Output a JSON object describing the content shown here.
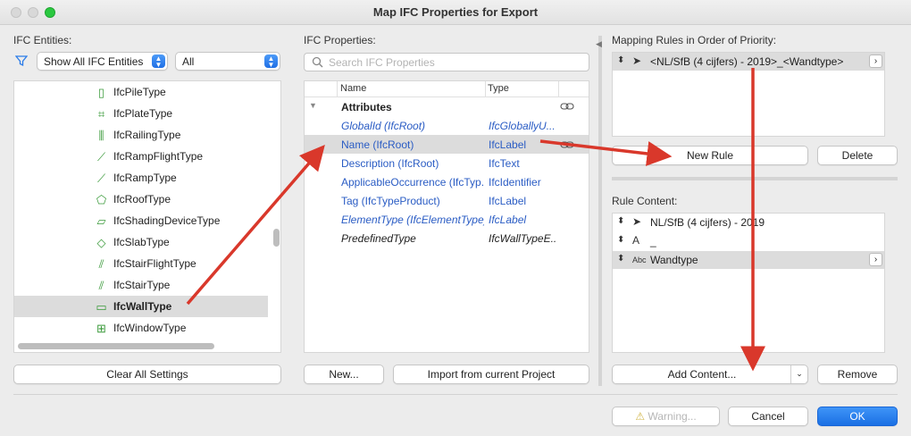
{
  "window": {
    "title": "Map IFC Properties for Export"
  },
  "entities": {
    "label": "IFC Entities:",
    "filter_popup": "Show All IFC Entities",
    "scope_popup": "All",
    "items": [
      {
        "label": "IfcPileType",
        "icon": "pile-icon"
      },
      {
        "label": "IfcPlateType",
        "icon": "plate-icon"
      },
      {
        "label": "IfcRailingType",
        "icon": "railing-icon"
      },
      {
        "label": "IfcRampFlightType",
        "icon": "ramp-flight-icon"
      },
      {
        "label": "IfcRampType",
        "icon": "ramp-icon"
      },
      {
        "label": "IfcRoofType",
        "icon": "roof-icon"
      },
      {
        "label": "IfcShadingDeviceType",
        "icon": "shading-device-icon"
      },
      {
        "label": "IfcSlabType",
        "icon": "slab-icon"
      },
      {
        "label": "IfcStairFlightType",
        "icon": "stair-flight-icon"
      },
      {
        "label": "IfcStairType",
        "icon": "stair-icon"
      },
      {
        "label": "IfcWallType",
        "icon": "wall-icon",
        "selected": true
      },
      {
        "label": "IfcWindowType",
        "icon": "window-icon"
      }
    ],
    "clear_button": "Clear All Settings"
  },
  "properties": {
    "label": "IFC Properties:",
    "search_placeholder": "Search IFC Properties",
    "col_name": "Name",
    "col_type": "Type",
    "group": "Attributes",
    "rows": [
      {
        "name": "GlobalId (IfcRoot)",
        "type": "IfcGloballyU...",
        "style": "blue ital"
      },
      {
        "name": "Name (IfcRoot)",
        "type": "IfcLabel",
        "style": "blue",
        "selected": true
      },
      {
        "name": "Description (IfcRoot)",
        "type": "IfcText",
        "style": "blue"
      },
      {
        "name": "ApplicableOccurrence (IfcTyp...",
        "type": "IfcIdentifier",
        "style": "blue"
      },
      {
        "name": "Tag (IfcTypeProduct)",
        "type": "IfcLabel",
        "style": "blue"
      },
      {
        "name": "ElementType (IfcElementType)",
        "type": "IfcLabel",
        "style": "blue ital"
      },
      {
        "name": "PredefinedType",
        "type": "IfcWallTypeE...",
        "style": "ital"
      }
    ],
    "new_button": "New...",
    "import_button": "Import from current Project"
  },
  "mapping": {
    "label": "Mapping Rules in Order of Priority:",
    "rules": [
      {
        "label": "<NL/SfB (4 cijfers) - 2019>_<Wandtype>",
        "selected": true
      }
    ],
    "new_rule_button": "New Rule",
    "delete_button": "Delete"
  },
  "rule_content": {
    "label": "Rule Content:",
    "items": [
      {
        "icon": "cursor-icon",
        "icon_glyph": "➤",
        "label": "NL/SfB (4 cijfers) - 2019"
      },
      {
        "icon": "text-a-icon",
        "icon_glyph": "A",
        "label": "_"
      },
      {
        "icon": "abc-icon",
        "icon_glyph": "Abc",
        "label": "Wandtype",
        "selected": true
      }
    ],
    "add_button": "Add Content...",
    "remove_button": "Remove"
  },
  "footer": {
    "warning_button": "Warning...",
    "cancel_button": "Cancel",
    "ok_button": "OK"
  },
  "colors": {
    "accent": "#1a6fe4",
    "arrow": "#d9382b",
    "selection": "#dcdcdc",
    "link": "#2a5cc4"
  }
}
